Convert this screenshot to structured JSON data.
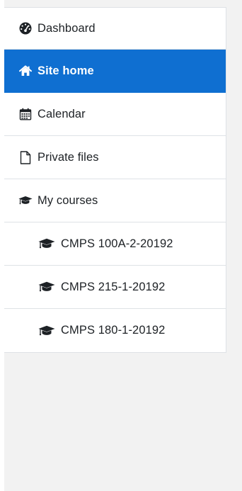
{
  "nav": {
    "items": [
      {
        "label": "Dashboard",
        "icon": "dashboard-icon",
        "active": false
      },
      {
        "label": "Site home",
        "icon": "home-icon",
        "active": true
      },
      {
        "label": "Calendar",
        "icon": "calendar-icon",
        "active": false
      },
      {
        "label": "Private files",
        "icon": "file-icon",
        "active": false
      },
      {
        "label": "My courses",
        "icon": "graduation-cap-icon",
        "active": false
      },
      {
        "label": "CMPS 100A-2-20192",
        "icon": "graduation-cap-icon",
        "active": false
      },
      {
        "label": "CMPS 215-1-20192",
        "icon": "graduation-cap-icon",
        "active": false
      },
      {
        "label": "CMPS 180-1-20192",
        "icon": "graduation-cap-icon",
        "active": false
      }
    ]
  },
  "colors": {
    "active_background": "#0f6fd1",
    "text": "#1d2125",
    "page_background": "#f2f2f2",
    "drawer_background": "#ffffff",
    "divider": "#dee2e6"
  }
}
